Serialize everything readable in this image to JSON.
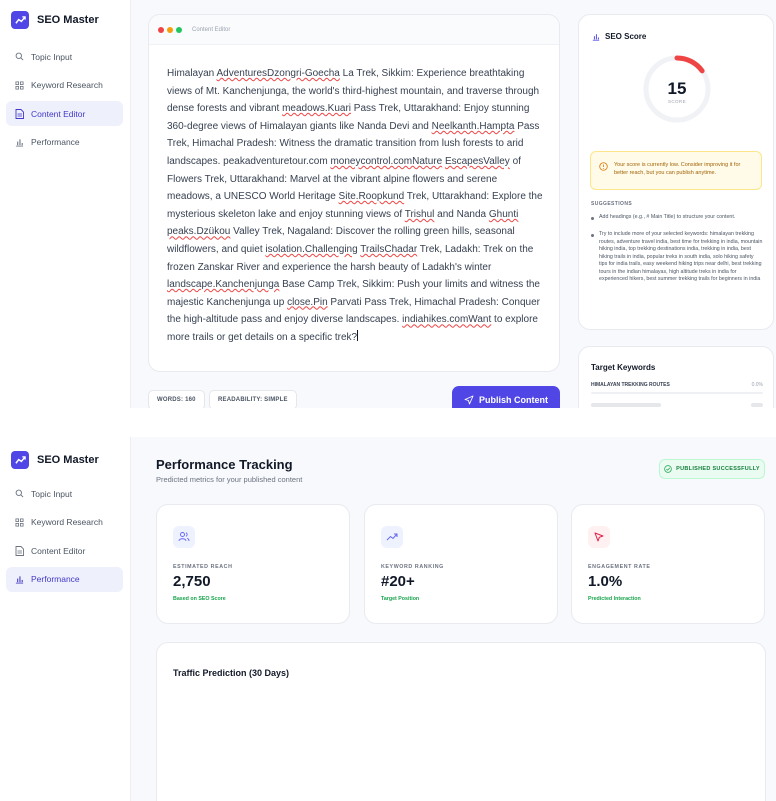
{
  "app": {
    "name": "SEO Master"
  },
  "sidebar": {
    "items": [
      {
        "label": "Topic Input",
        "icon": "search-icon"
      },
      {
        "label": "Keyword Research",
        "icon": "grid-icon"
      },
      {
        "label": "Content Editor",
        "icon": "document-icon"
      },
      {
        "label": "Performance",
        "icon": "bar-chart-icon"
      }
    ]
  },
  "editor": {
    "window_dots": [
      "#ef4444",
      "#f59e0b",
      "#22c55e"
    ],
    "title": "Content Editor",
    "segments": [
      "Himalayan ",
      "AdventuresDzongri-Goecha",
      " La Trek, Sikkim: Experience breathtaking views of Mt. Kanchenjunga, the world's third-highest mountain, and traverse through dense forests and vibrant ",
      "meadows.Kuari",
      " Pass Trek, Uttarakhand: Enjoy stunning 360-degree views of Himalayan giants like Nanda Devi and ",
      "Neelkanth.Hampta",
      " Pass Trek, Himachal Pradesh: Witness the dramatic transition from lush forests to arid landscapes. peakadventuretour.com ",
      "moneycontrol.comNature",
      " ",
      "EscapesValley",
      " of Flowers Trek, Uttarakhand: Marvel at the vibrant alpine flowers and serene meadows, a UNESCO World Heritage ",
      "Site.Roopkund",
      " Trek, Uttarakhand: Explore the mysterious skeleton lake and enjoy stunning views of ",
      "Trishul",
      " and Nanda ",
      "Ghunti",
      " ",
      "peaks.Dzükou",
      " Valley Trek, Nagaland: Discover the rolling green hills, seasonal wildflowers, and quiet ",
      "isolation.Challenging",
      " ",
      "TrailsChadar",
      " Trek, Ladakh: Trek on the frozen Zanskar River and experience the harsh beauty of Ladakh's winter ",
      "landscape.Kanchenjunga",
      " Base Camp Trek, Sikkim: Push your limits and witness the majestic Kanchenjunga up ",
      "close.Pin",
      " Parvati Pass Trek, Himachal Pradesh: Conquer the high-altitude pass and enjoy diverse landscapes. ",
      "indiahikes.comWant",
      " to explore more trails or get details on a specific trek?"
    ],
    "words_label": "WORDS: 160",
    "readability_label": "READABILITY: SIMPLE",
    "publish_label": "Publish Content"
  },
  "seo": {
    "title": "SEO Score",
    "score": 15,
    "score_label": "SCORE",
    "gauge_color": "#ef4444",
    "warning": "Your score is currently low. Consider improving it for better reach, but you can publish anytime.",
    "suggestions_title": "SUGGESTIONS",
    "suggestions": [
      "Add headings (e.g., # Main Title) to structure your content.",
      "Try to include more of your selected keywords: himalayan trekking routes, adventure travel india, best time for trekking in india, mountain hiking india, top trekking destinations india, trekking in india, best hiking trails in india, popular treks in south india, solo hiking safety tips for india trails, easy weekend hiking trips near delhi, best trekking tours in the indian himalayas, high altitude treks in india for experienced hikers, best summer trekking trails for beginners in india"
    ]
  },
  "keywords": {
    "title": "Target Keywords",
    "items": [
      {
        "name": "HIMALAYAN TREKKING ROUTES",
        "value": "0.0%"
      }
    ]
  },
  "performance": {
    "title": "Performance Tracking",
    "subtitle": "Predicted metrics for your published content",
    "badge": "PUBLISHED SUCCESSFULLY",
    "metrics": [
      {
        "label": "ESTIMATED REACH",
        "value": "2,750",
        "sub": "Based on SEO Score",
        "icon": "users-icon",
        "color": "#6366f1",
        "bg": "#eef2ff"
      },
      {
        "label": "KEYWORD RANKING",
        "value": "#20+",
        "sub": "Target Position",
        "icon": "trending-up-icon",
        "color": "#6366f1",
        "bg": "#eef2ff"
      },
      {
        "label": "ENGAGEMENT RATE",
        "value": "1.0%",
        "sub": "Predicted Interaction",
        "icon": "cursor-icon",
        "color": "#e11d48",
        "bg": "#fff1f2"
      }
    ],
    "traffic_title": "Traffic Prediction (30 Days)"
  },
  "colors": {
    "accent": "#4f46e5",
    "success": "#16a34a",
    "warning": "#a16207"
  }
}
